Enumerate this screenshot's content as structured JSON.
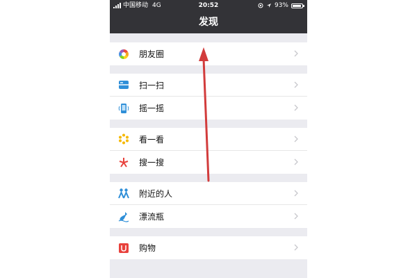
{
  "status_bar": {
    "carrier": "中国移动",
    "network": "4G",
    "time": "20:52",
    "battery": "93%",
    "battery_level": 0.93
  },
  "nav": {
    "title": "发现"
  },
  "menu": [
    {
      "label": "朋友圈",
      "icon": "moments-icon"
    },
    {
      "label": "扫一扫",
      "icon": "scan-icon"
    },
    {
      "label": "摇一摇",
      "icon": "shake-icon"
    },
    {
      "label": "看一看",
      "icon": "top-stories-icon"
    },
    {
      "label": "搜一搜",
      "icon": "search-icon"
    },
    {
      "label": "附近的人",
      "icon": "people-nearby-icon"
    },
    {
      "label": "漂流瓶",
      "icon": "drift-bottle-icon"
    },
    {
      "label": "购物",
      "icon": "shopping-icon"
    }
  ],
  "colors": {
    "header": "#333337",
    "background": "#ebebf0",
    "annotation_arrow": "#d23c3c"
  }
}
